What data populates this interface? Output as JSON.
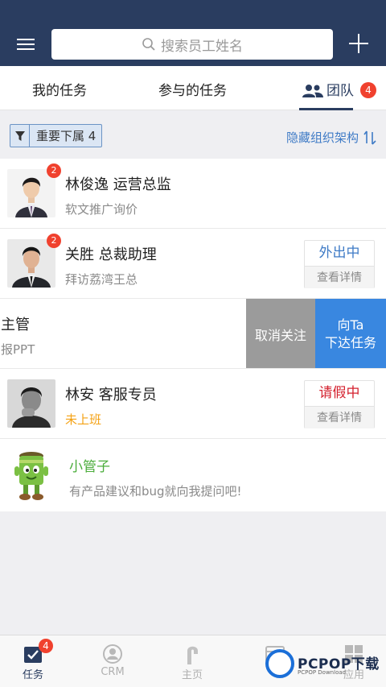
{
  "header": {
    "search_placeholder": "搜索员工姓名"
  },
  "tabs": {
    "mine": "我的任务",
    "joined": "参与的任务",
    "team": "团队",
    "team_badge": "4"
  },
  "filter": {
    "label": "重要下属 4"
  },
  "org_toggle": "隐藏组织架构",
  "members": [
    {
      "name": "林俊逸 运营总监",
      "task": "软文推广询价",
      "badge": "2"
    },
    {
      "name": "关胜 总裁助理",
      "task": "拜访荔湾王总",
      "badge": "2",
      "status": "外出中",
      "detail": "查看详情"
    },
    {
      "name": "主管",
      "task": "报PPT"
    },
    {
      "name": "林安 客服专员",
      "task": "未上班",
      "status": "请假中",
      "detail": "查看详情"
    }
  ],
  "swipe_actions": {
    "unfollow": "取消关注",
    "assign_line1": "向Ta",
    "assign_line2": "下达任务"
  },
  "bot": {
    "name": "小管子",
    "message": "有产品建议和bug就向我提问吧!"
  },
  "bottom_nav": {
    "tasks": "任务",
    "tasks_badge": "4",
    "crm": "CRM",
    "home": "主页",
    "apps": "应用"
  },
  "watermark": {
    "text": "PCPOP下载",
    "small": "PCPOP Download"
  },
  "colors": {
    "header": "#2a3d60",
    "badge": "#f0412e",
    "link_blue": "#3f7bc6",
    "assign_blue": "#3987e0",
    "unfollow_gray": "#9b9b9b",
    "leave_red": "#d4222f",
    "offline_orange": "#f4a113",
    "bot_green": "#4bad3b"
  }
}
